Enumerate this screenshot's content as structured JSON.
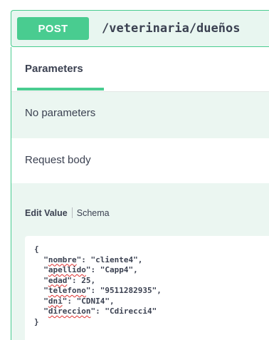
{
  "operation": {
    "method": "POST",
    "path": "/veterinaria/dueños",
    "colors": {
      "accent": "#49cc90",
      "tint": "#ebf6f1",
      "text": "#3b4151"
    }
  },
  "tabs": {
    "parameters_label": "Parameters"
  },
  "parameters": {
    "empty_text": "No parameters"
  },
  "request_body": {
    "label": "Request body",
    "edit_value_tab": "Edit Value",
    "schema_tab": "Schema",
    "code": {
      "open": "{",
      "close": "}",
      "lines": [
        {
          "key": "nombre",
          "value": "\"cliente4\","
        },
        {
          "key": "apellido",
          "value": "\"Capp4\","
        },
        {
          "key": "edad",
          "value": "25,"
        },
        {
          "key": "telefono",
          "value": "\"9511282935\","
        },
        {
          "key": "dni",
          "value": "\"CDNI4\","
        },
        {
          "key": "direccion",
          "value": "\"Cdirecci4\""
        }
      ]
    }
  }
}
